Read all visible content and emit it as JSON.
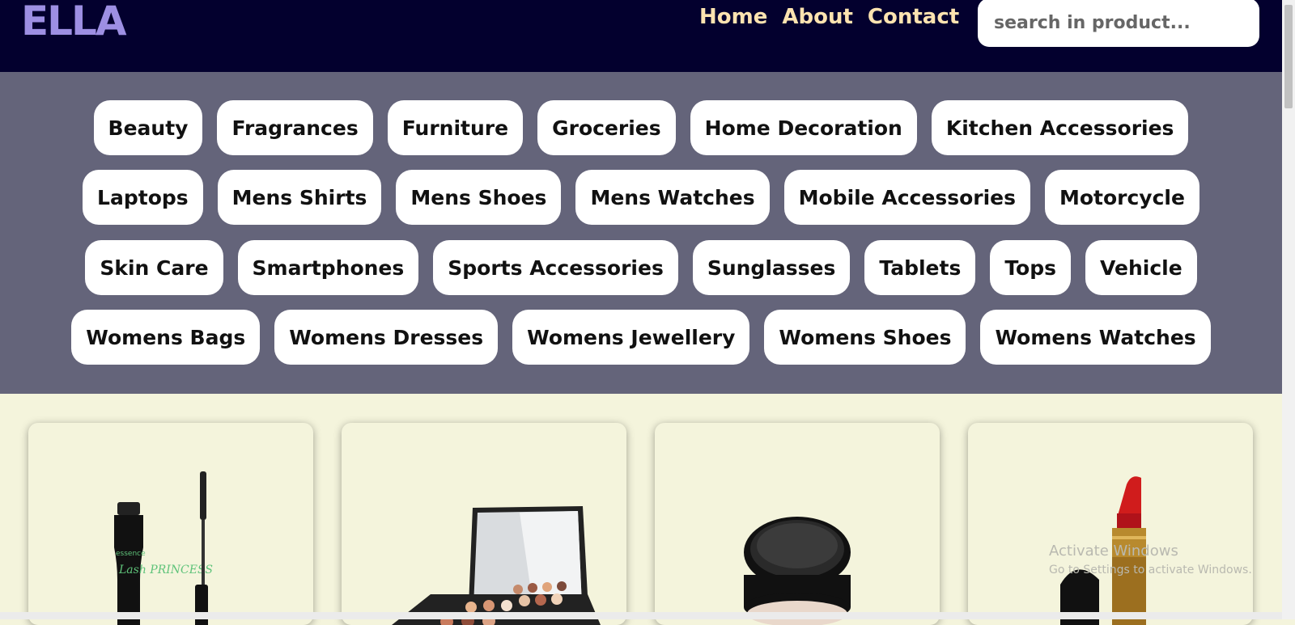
{
  "brand": {
    "logo_text": "ELLA"
  },
  "nav": {
    "links": [
      "Home",
      "About",
      "Contact"
    ]
  },
  "search": {
    "placeholder": "search in product..."
  },
  "categories": {
    "rows": [
      [
        "Beauty",
        "Fragrances",
        "Furniture",
        "Groceries",
        "Home Decoration",
        "Kitchen Accessories"
      ],
      [
        "Laptops",
        "Mens Shirts",
        "Mens Shoes",
        "Mens Watches",
        "Mobile Accessories",
        "Motorcycle"
      ],
      [
        "Skin Care",
        "Smartphones",
        "Sports Accessories",
        "Sunglasses",
        "Tablets",
        "Tops",
        "Vehicle"
      ],
      [
        "Womens Bags",
        "Womens Dresses",
        "Womens Jewellery",
        "Womens Shoes",
        "Womens Watches"
      ]
    ]
  },
  "products": [
    {
      "image": "mascara",
      "brand_text": "essence",
      "label_text": "Lash PRINCESS"
    },
    {
      "image": "eyeshadow-palette"
    },
    {
      "image": "powder-compact"
    },
    {
      "image": "red-lipstick"
    }
  ],
  "watermark": {
    "title": "Activate Windows",
    "subtitle": "Go to Settings to activate Windows."
  },
  "colors": {
    "navbar": "#03002e",
    "logo": "#9d8fe3",
    "nav_link": "#fde3b0",
    "category_band": "#64647a",
    "page_bg": "#f4f4dc"
  }
}
